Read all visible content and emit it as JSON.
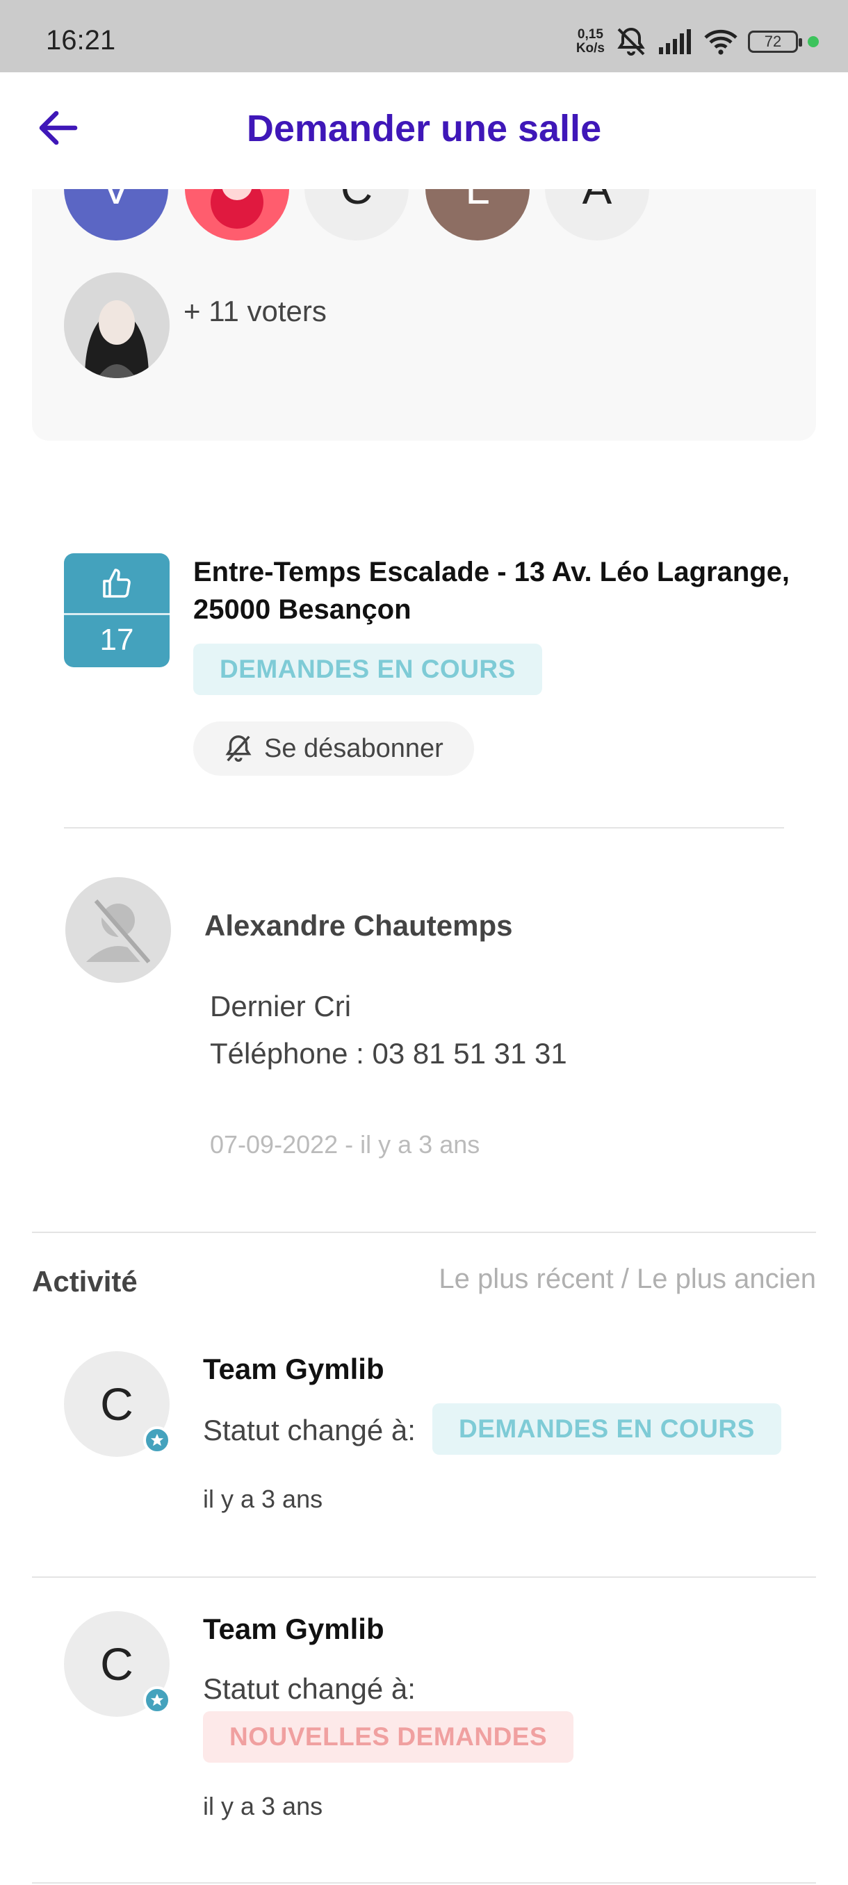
{
  "status_bar": {
    "time": "16:21",
    "net_speed_value": "0,15",
    "net_speed_unit": "Ko/s",
    "battery": "72"
  },
  "header": {
    "title": "Demander une salle"
  },
  "voters": {
    "avatars": [
      {
        "letter": "V",
        "color": "#5b66c4"
      },
      {
        "letter": "",
        "color": "#ff5d6e"
      },
      {
        "letter": "C",
        "color": "#eeeeee"
      },
      {
        "letter": "L",
        "color": "#8d6e63"
      },
      {
        "letter": "A",
        "color": "#eeeeee"
      }
    ],
    "more_label": "+ 11 voters"
  },
  "request": {
    "votes": "17",
    "title": "Entre-Temps Escalade - 13 Av. Léo Lagrange, 25000 Besançon",
    "status": "DEMANDES EN COURS",
    "unsubscribe_label": "Se désabonner"
  },
  "author": {
    "name": "Alexandre Chautemps",
    "line1": "Dernier Cri",
    "line2": "Téléphone : 03 81 51 31 31",
    "date": "07-09-2022 - il y a 3 ans"
  },
  "activity": {
    "title": "Activité",
    "sort_label": "Le plus récent / Le plus ancien",
    "items": [
      {
        "avatar_letter": "C",
        "name": "Team Gymlib",
        "status_prefix": "Statut changé à:",
        "status": "DEMANDES EN COURS",
        "time": "il y a 3 ans"
      },
      {
        "avatar_letter": "C",
        "name": "Team Gymlib",
        "status_prefix": "Statut changé à:",
        "status": "NOUVELLES DEMANDES",
        "time": "il y a 3 ans"
      }
    ]
  },
  "colors": {
    "accent": "#3f17b8",
    "vote_box": "#44a2bd",
    "status_in_progress_bg": "#e5f5f7",
    "status_in_progress_text": "#7ecbd6",
    "status_new_bg": "#fde9e9",
    "status_new_text": "#f0a0a0"
  }
}
